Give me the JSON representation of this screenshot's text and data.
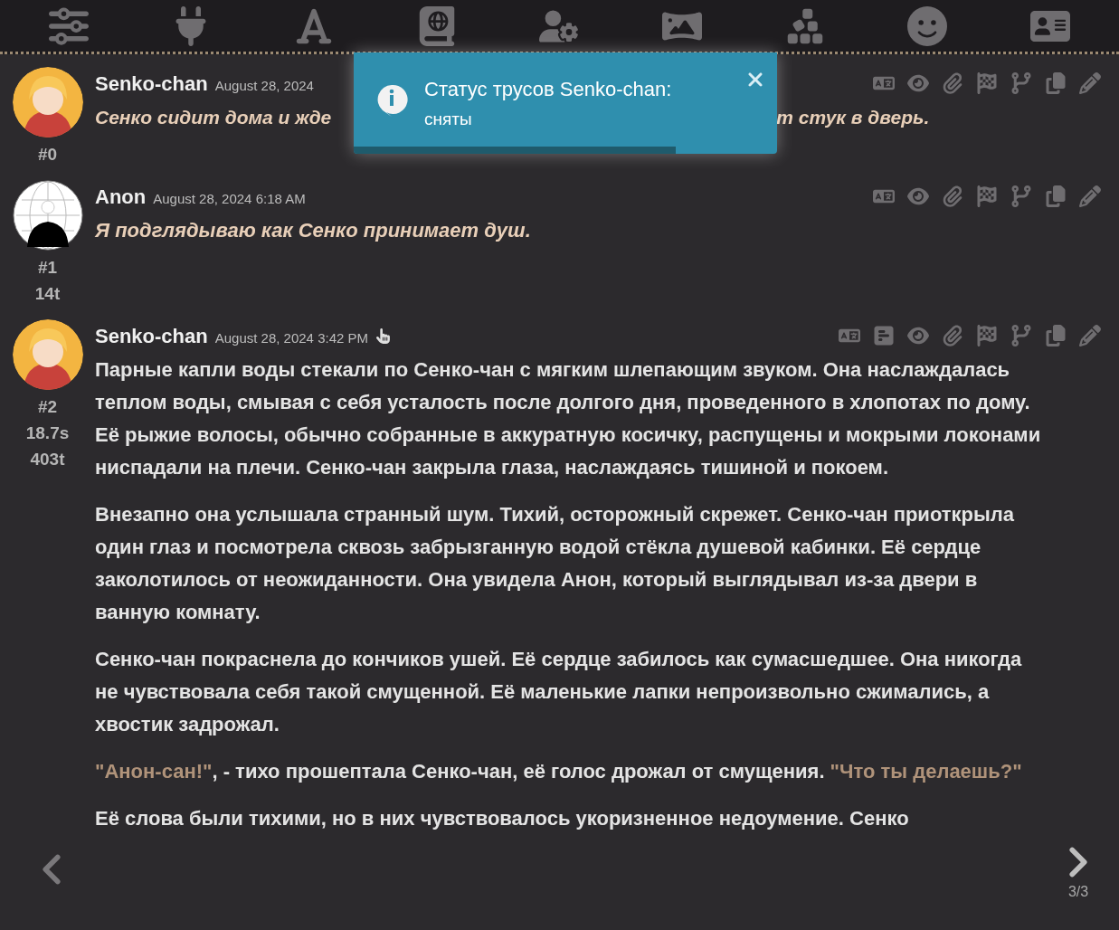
{
  "toast": {
    "title": "Статус трусов Senko-chan:",
    "message": "сняты",
    "level": 0.76
  },
  "messages": [
    {
      "name": "Senko-chan",
      "date": "August 28, 2024",
      "is_user": false,
      "extra_icon": false,
      "summary": false,
      "stats": [
        "#0"
      ],
      "paragraphs": [
        [
          {
            "kind": "italic",
            "text": "Сенко сидит дома и жде"
          },
          {
            "kind": "gap",
            "text": "т стук в дверь."
          }
        ]
      ]
    },
    {
      "name": "Anon",
      "date": "August 28, 2024 6:18 AM",
      "is_user": true,
      "extra_icon": false,
      "summary": false,
      "stats": [
        "#1",
        "14t"
      ],
      "paragraphs": [
        [
          {
            "kind": "italic",
            "text": "Я подглядываю как Сенко принимает душ."
          }
        ]
      ]
    },
    {
      "name": "Senko-chan",
      "date": "August 28, 2024 3:42 PM",
      "is_user": false,
      "extra_icon": true,
      "summary": true,
      "stats": [
        "#2",
        "18.7s",
        "403t"
      ],
      "swipe_counter": "3/3",
      "paragraphs": [
        [
          {
            "kind": "plain",
            "text": "Парные капли воды стекали по Сенко-чан с мягким шлепающим звуком. Она наслаждалась теплом воды, смывая с себя усталость после долгого дня, проведенного в хлопотах по дому. Её рыжие волосы, обычно собранные в аккуратную косичку, распущены и мокрыми локонами ниспадали на плечи. Сенко-чан закрыла глаза, наслаждаясь тишиной и покоем."
          }
        ],
        [
          {
            "kind": "plain",
            "text": "Внезапно она услышала странный шум. Тихий, осторожный скрежет. Сенко-чан приоткрыла один глаз и посмотрела сквозь забрызганную водой стёкла душевой кабинки. Её сердце заколотилось от неожиданности. Она увидела Анон, который выглядывал из-за двери в ванную комнату."
          }
        ],
        [
          {
            "kind": "plain",
            "text": "Сенко-чан покраснела до кончиков ушей. Её сердце забилось как сумасшедшее. Она никогда не чувствовала себя такой смущенной. Её маленькие лапки непроизвольно сжимались, а хвостик задрожал."
          }
        ],
        [
          {
            "kind": "quote",
            "text": "\"Анон-сан!\""
          },
          {
            "kind": "plain",
            "text": ", - тихо прошептала Сенко-чан, её голос дрожал от смущения. "
          },
          {
            "kind": "quote",
            "text": "\"Что ты делаешь?\""
          }
        ],
        [
          {
            "kind": "cut",
            "text": "Её слова были тихими, но в них чувствовалось укоризненное недоумение. Сенко"
          }
        ]
      ]
    }
  ]
}
